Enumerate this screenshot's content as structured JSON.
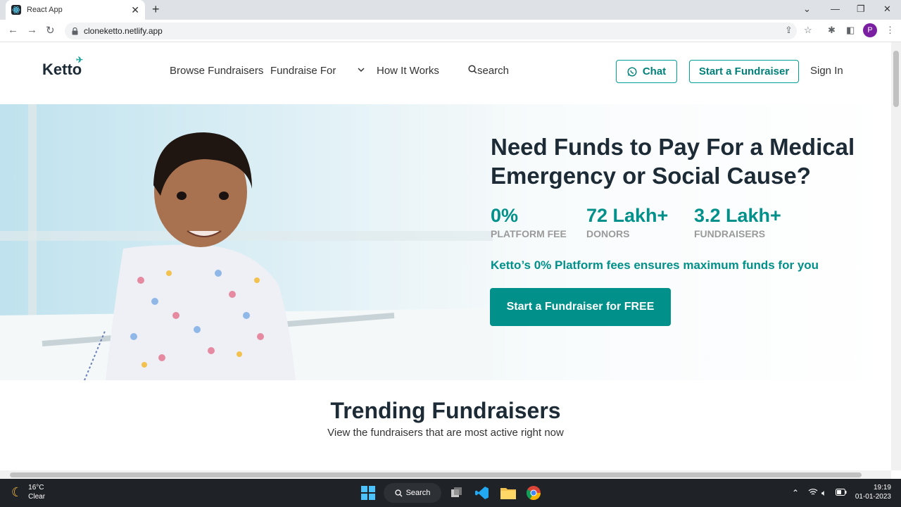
{
  "browser": {
    "tab_title": "React App",
    "url": "cloneketto.netlify.app",
    "profile_initial": "P"
  },
  "header": {
    "logo": "Ketto",
    "nav": [
      "Browse Fundraisers",
      "Fundraise For",
      "How It Works"
    ],
    "search": "search",
    "chat": "Chat",
    "start_fundraiser": "Start a Fundraiser",
    "sign_in": "Sign In"
  },
  "hero": {
    "headline_line1": "Need Funds to Pay For a Medical",
    "headline_line2": "Emergency or Social Cause?",
    "stats": [
      {
        "value": "0%",
        "label": "PLATFORM FEE"
      },
      {
        "value": "72 Lakh+",
        "label": "DONORS"
      },
      {
        "value": "3.2 Lakh+",
        "label": "FUNDRAISERS"
      }
    ],
    "tagline": "Ketto’s 0% Platform fees ensures maximum funds for you",
    "cta": "Start a Fundraiser for FREE"
  },
  "trending": {
    "title": "Trending Fundraisers",
    "subtitle": "View the fundraisers that are most active right now"
  },
  "taskbar": {
    "temp": "16°C",
    "condition": "Clear",
    "search": "Search",
    "time": "19:19",
    "date": "01-01-2023"
  },
  "colors": {
    "brand": "#01908a",
    "heading": "#1d2b36"
  }
}
